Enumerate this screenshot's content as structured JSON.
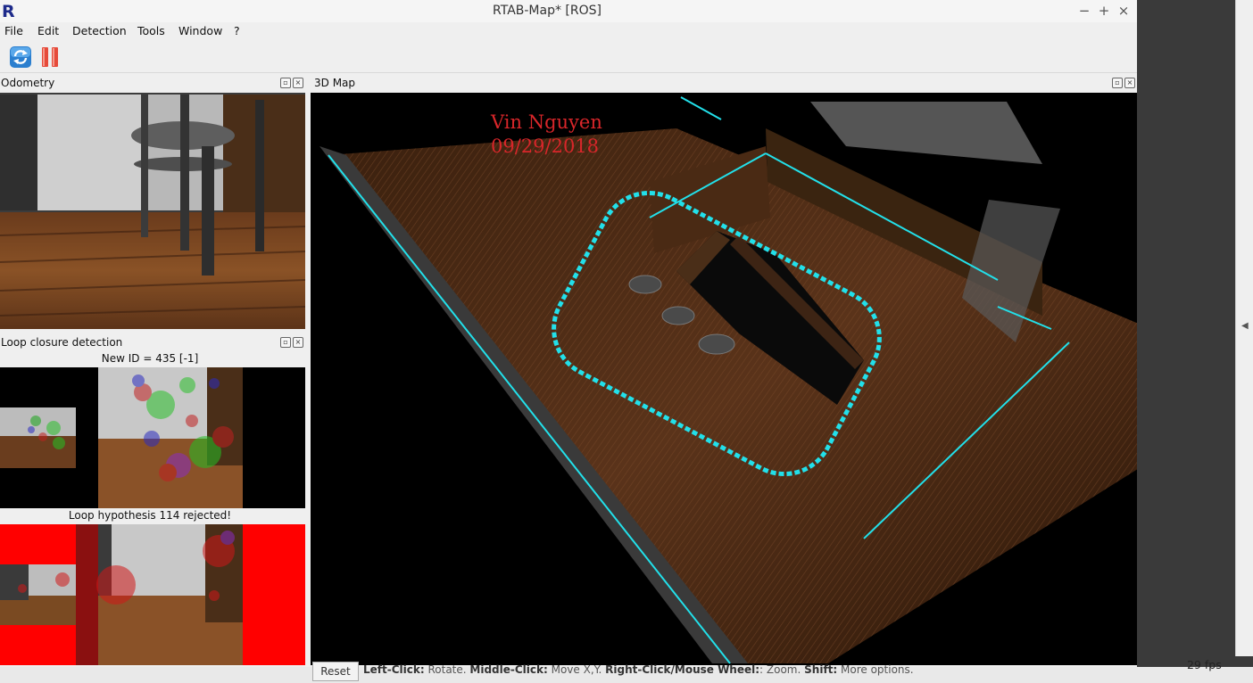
{
  "window": {
    "logo": "R",
    "title": "RTAB-Map* [ROS]",
    "controls": {
      "minimize": "−",
      "maximize": "+",
      "close": "×"
    }
  },
  "menu": [
    {
      "label": "File"
    },
    {
      "label": "Edit"
    },
    {
      "label": "Detection"
    },
    {
      "label": "Tools"
    },
    {
      "label": "Window"
    },
    {
      "label": "?"
    }
  ],
  "toolbar": {
    "icons": [
      "refresh-icon",
      "pause-icon"
    ],
    "accent": "#e64a3a"
  },
  "odometry": {
    "title": "Odometry"
  },
  "loop_closure": {
    "title": "Loop closure detection",
    "new_id_text": "New ID = 435 [-1]",
    "hypothesis_text": "Loop hypothesis 114 rejected!"
  },
  "map3d": {
    "title": "3D Map",
    "overlay_name": "Vin Nguyen",
    "overlay_date": "09/29/2018",
    "trajectory_color": "#22e0ea",
    "overlay_color": "#d8262a"
  },
  "status": {
    "reset_label": "Reset",
    "hint_parts": [
      {
        "k": "Left-Click:",
        "v": " Rotate. "
      },
      {
        "k": "Middle-Click:",
        "v": " Move X,Y. "
      },
      {
        "k": "Right-Click/Mouse Wheel:",
        "v": ": Zoom. "
      },
      {
        "k": "Shift:",
        "v": " More options."
      }
    ],
    "fps": "29 fps"
  }
}
